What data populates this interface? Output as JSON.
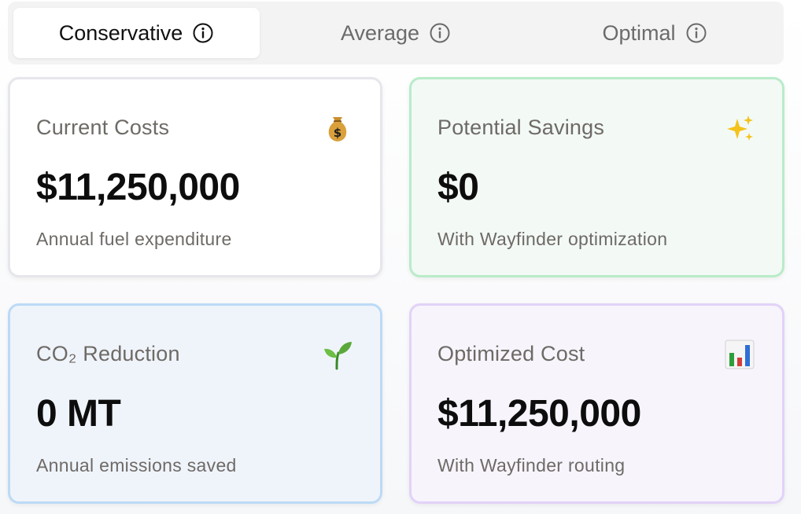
{
  "tabs": [
    {
      "label": "Conservative",
      "active": true
    },
    {
      "label": "Average",
      "active": false
    },
    {
      "label": "Optimal",
      "active": false
    }
  ],
  "cards": {
    "current_costs": {
      "title": "Current Costs",
      "value": "$11,250,000",
      "subtitle": "Annual fuel expenditure",
      "icon": "money-bag-icon"
    },
    "potential_savings": {
      "title": "Potential Savings",
      "value": "$0",
      "subtitle": "With Wayfinder optimization",
      "icon": "sparkles-icon"
    },
    "co2_reduction": {
      "title": "CO₂ Reduction",
      "value": "0 MT",
      "subtitle": "Annual emissions saved",
      "icon": "seedling-icon"
    },
    "optimized_cost": {
      "title": "Optimized Cost",
      "value": "$11,250,000",
      "subtitle": "With Wayfinder routing",
      "icon": "bar-chart-icon"
    }
  },
  "colors": {
    "savings_border": "#b8ecc9",
    "co2_border": "#bcdaf6",
    "optimized_border": "#e2d2f8"
  }
}
